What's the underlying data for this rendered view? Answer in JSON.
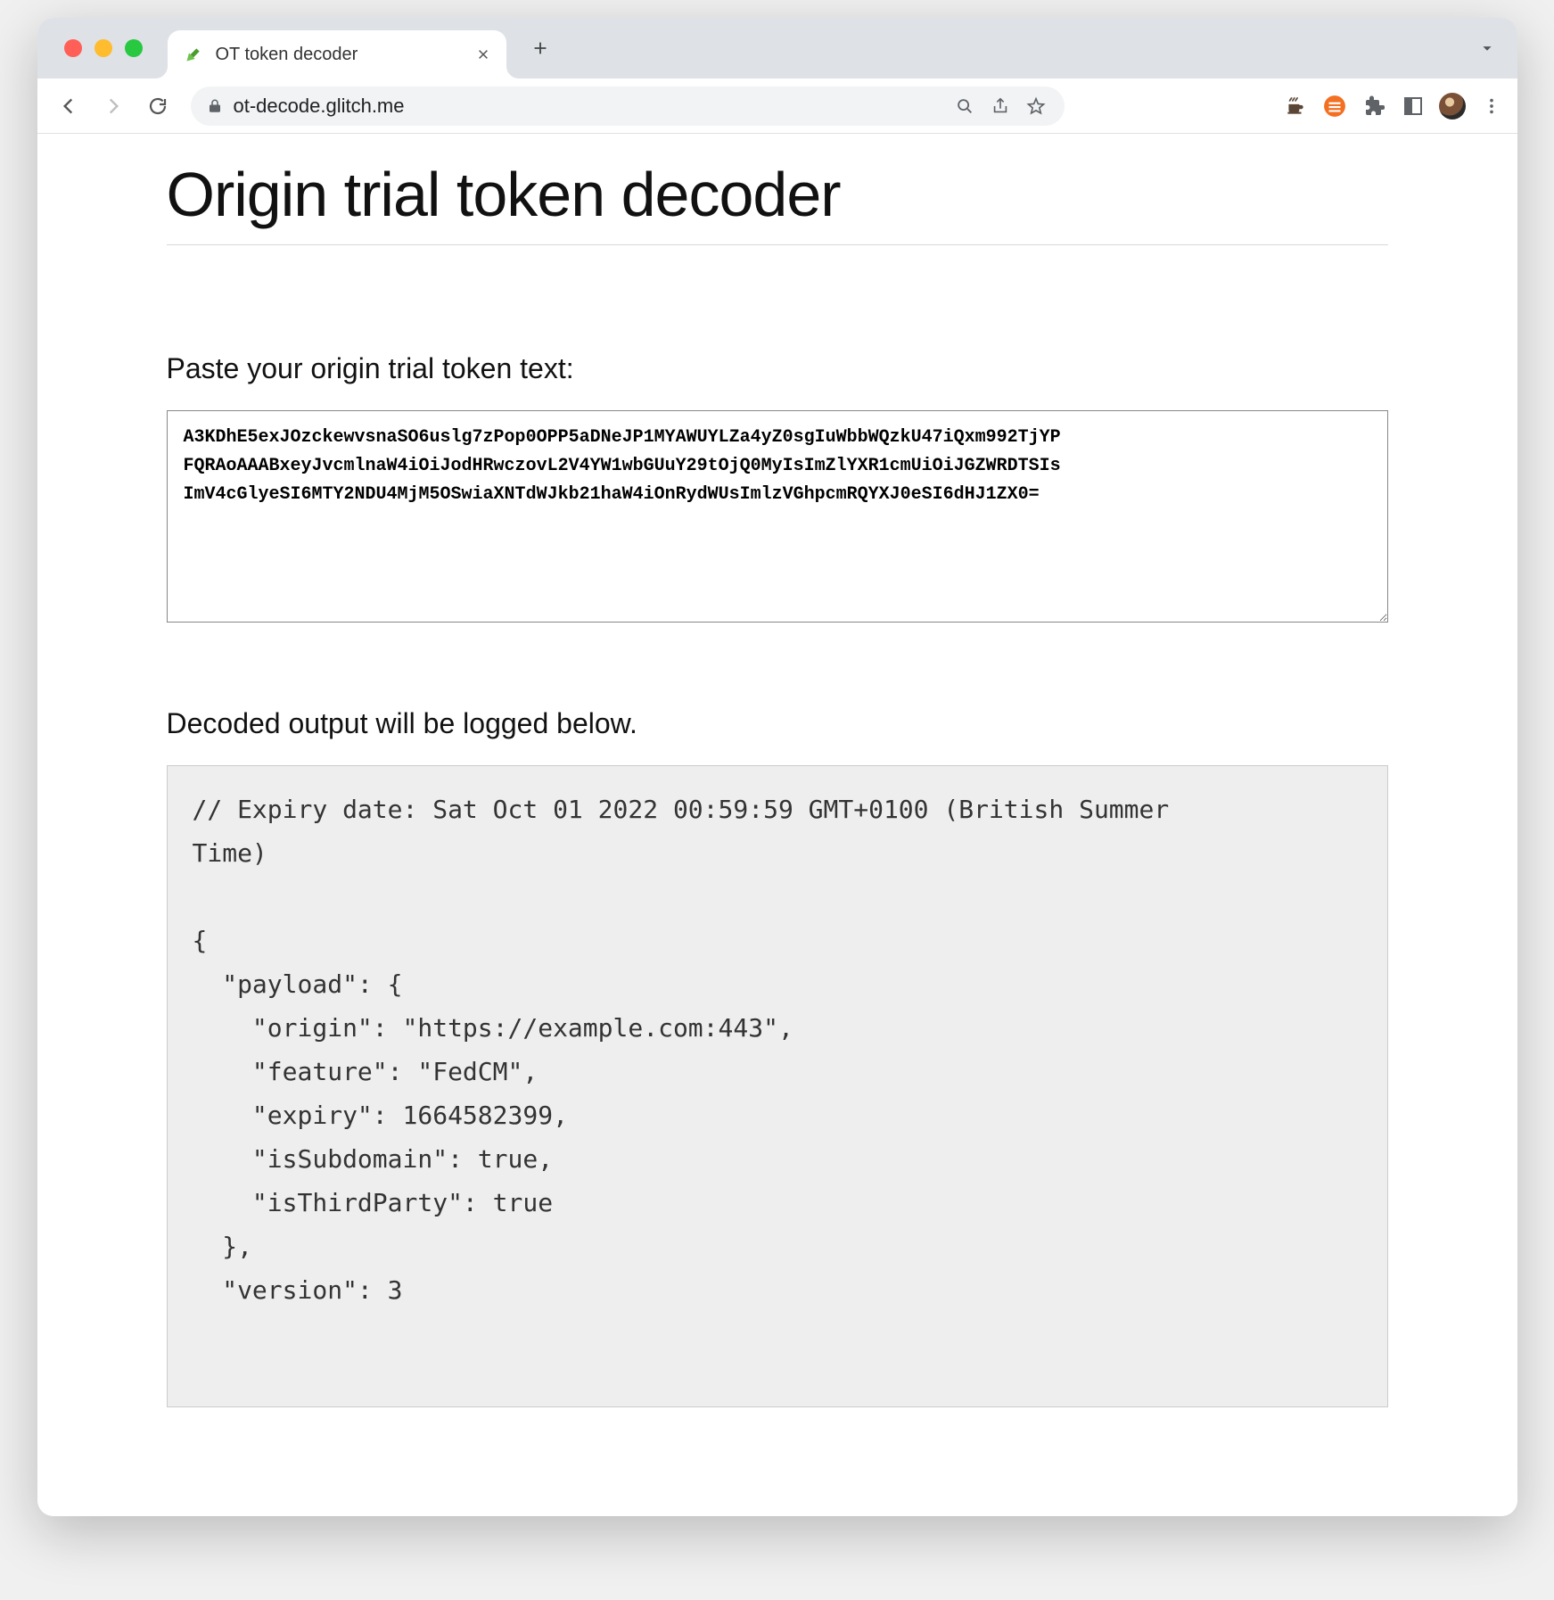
{
  "browser": {
    "tab_title": "OT token decoder",
    "url": "ot-decode.glitch.me"
  },
  "page": {
    "heading": "Origin trial token decoder",
    "paste_label": "Paste your origin trial token text:",
    "token_value": "A3KDhE5exJOzckewvsnaSO6uslg7zPop0OPP5aDNeJP1MYAWUYLZa4yZ0sgIuWbbWQzkU47iQxm992TjYP\nFQRAoAAABxeyJvcmlnaW4iOiJodHRwczovL2V4YW1wbGUuY29tOjQ0MyIsImZlYXR1cmUiOiJGZWRDTSIs\nImV4cGlyeSI6MTY2NDU4MjM5OSwiaXNTdWJkb21haW4iOnRydWUsImlzVGhpcmRQYXJ0eSI6dHJ1ZX0=",
    "output_label": "Decoded output will be logged below.",
    "decoded_comment": "// Expiry date: Sat Oct 01 2022 00:59:59 GMT+0100 (British Summer Time)",
    "decoded": {
      "payload": {
        "origin": "https://example.com:443",
        "feature": "FedCM",
        "expiry": 1664582399,
        "isSubdomain": true,
        "isThirdParty": true
      },
      "version": 3
    }
  }
}
